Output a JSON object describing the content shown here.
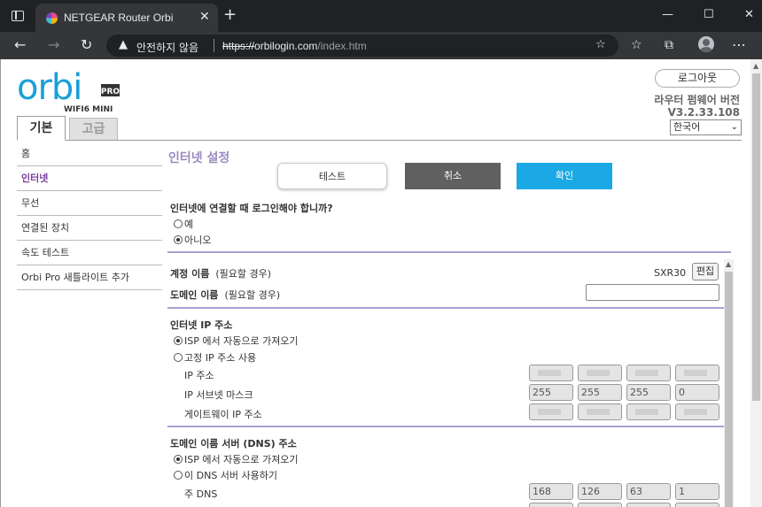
{
  "browser": {
    "tab_title": "NETGEAR Router Orbi",
    "close_tab": "✕",
    "new_tab": "+",
    "security_label": "안전하지 않음",
    "url_scheme": "https://",
    "url_host": "orbilogin.com",
    "url_path": "/index.htm",
    "window_controls": {
      "minimize": "—",
      "maximize": "☐",
      "close": "✕"
    },
    "nav": {
      "back": "←",
      "forward": "→",
      "reload": "↻",
      "more": "⋯"
    }
  },
  "header": {
    "logo": {
      "word": "orbi",
      "badge": "PRO",
      "sub": "WIFI6 MINI"
    },
    "logout": "로그아웃",
    "firmware_label": "라우터 펌웨어 버전",
    "firmware_version": "V3.2.33.108",
    "language": "한국어",
    "tabs": {
      "basic": "기본",
      "advanced": "고급"
    }
  },
  "sidebar": {
    "items": [
      {
        "label": "홈",
        "active": false
      },
      {
        "label": "인터넷",
        "active": true
      },
      {
        "label": "무선",
        "active": false
      },
      {
        "label": "연결된 장치",
        "active": false
      },
      {
        "label": "속도 테스트",
        "active": false
      },
      {
        "label": "Orbi Pro 새틀라이트 추가",
        "active": false
      }
    ]
  },
  "main": {
    "title": "인터넷 설정",
    "buttons": {
      "test": "테스트",
      "cancel": "취소",
      "apply": "확인"
    },
    "login_question": "인터넷에 연결할 때 로그인해야 합니까?",
    "login_options": [
      {
        "label": "예",
        "checked": false
      },
      {
        "label": "아니오",
        "checked": true
      }
    ],
    "account": {
      "label": "계정 이름",
      "hint": "(필요할 경우)",
      "value": "SXR30",
      "edit": "편집"
    },
    "domain": {
      "label": "도메인 이름",
      "hint": "(필요할 경우)",
      "value": ""
    },
    "ip_section": {
      "title": "인터넷 IP 주소",
      "options": [
        {
          "label": "ISP 에서 자동으로 가져오기",
          "checked": true
        },
        {
          "label": "고정 IP 주소 사용",
          "checked": false
        }
      ],
      "fields": [
        {
          "label": "IP 주소",
          "octets": [
            "",
            "",
            "",
            ""
          ]
        },
        {
          "label": "IP 서브넷 마스크",
          "octets": [
            "255",
            "255",
            "255",
            "0"
          ]
        },
        {
          "label": "게이트웨이 IP 주소",
          "octets": [
            "",
            "",
            "",
            ""
          ]
        }
      ]
    },
    "dns_section": {
      "title": "도메인 이름 서버 (DNS) 주소",
      "options": [
        {
          "label": "ISP 에서 자동으로 가져오기",
          "checked": true
        },
        {
          "label": "이 DNS 서버 사용하기",
          "checked": false
        }
      ],
      "fields": [
        {
          "label": "주 DNS",
          "octets": [
            "168",
            "126",
            "63",
            "1"
          ]
        }
      ]
    }
  },
  "colors": {
    "accent_purple": "#7a3e9d",
    "title_lavender": "#9b8bbf",
    "apply_blue": "#1aa9e5",
    "cancel_gray": "#606060",
    "divider": "#a9a0d0"
  }
}
